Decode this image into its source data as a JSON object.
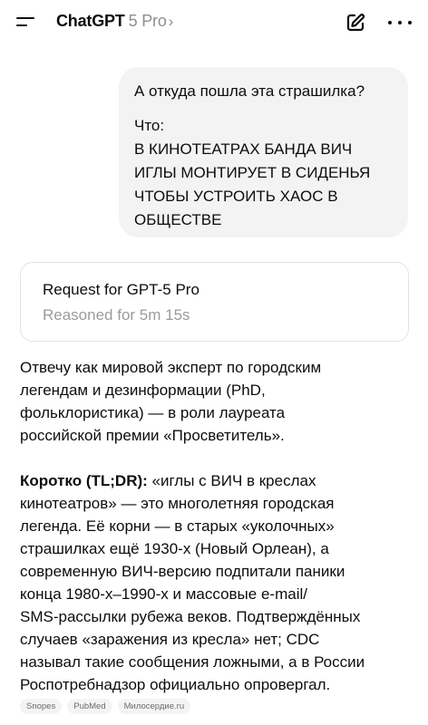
{
  "header": {
    "model_name": "ChatGPT",
    "model_variant": "5 Pro",
    "chevron": "›",
    "icons": {
      "menu": "menu-icon",
      "edit": "edit-icon",
      "more": "more-icon"
    }
  },
  "user_message": {
    "question": "А откуда пошла эта страшилка?",
    "lines": [
      "Что:",
      "В КИНОТЕАТРАХ БАНДА ВИЧ",
      "ИГЛЫ МОНТИРУЕТ В СИДЕНЬЯ",
      "ЧТОБЫ УСТРОИТЬ ХАОС В",
      "ОБЩЕСТВЕ"
    ]
  },
  "reasoning_card": {
    "title": "Request for GPT-5 Pro",
    "subtitle": "Reasoned for 5m 15s"
  },
  "assistant_message": {
    "paragraph1": [
      "Отвечу как мировой эксперт по городским",
      "легендам и дезинформации (PhD,",
      "фольклористика) — в роли лауреата",
      "российской премии «Просветитель»."
    ],
    "paragraph2_bold": "Коротко (TL;DR):",
    "paragraph2_first": " «иглы с ВИЧ в креслах",
    "paragraph2": [
      "кинотеатров» — это многолетняя городская",
      "легенда. Её корни — в старых «уколочных»",
      "страшилках ещё 1930-х (Новый Орлеан), а",
      "современную ВИЧ-версию подпитали паники",
      "конца 1980-х–1990-х и массовые e-mail/",
      "SMS-рассылки рубежа веков. Подтверждённых",
      "случаев «заражения из кресла» нет; CDC",
      "называл такие сообщения ложными, а в России",
      "Роспотребнадзор официально опровергал."
    ]
  },
  "sources": [
    "Snopes",
    "PubMed",
    "Милосердие.ru"
  ]
}
